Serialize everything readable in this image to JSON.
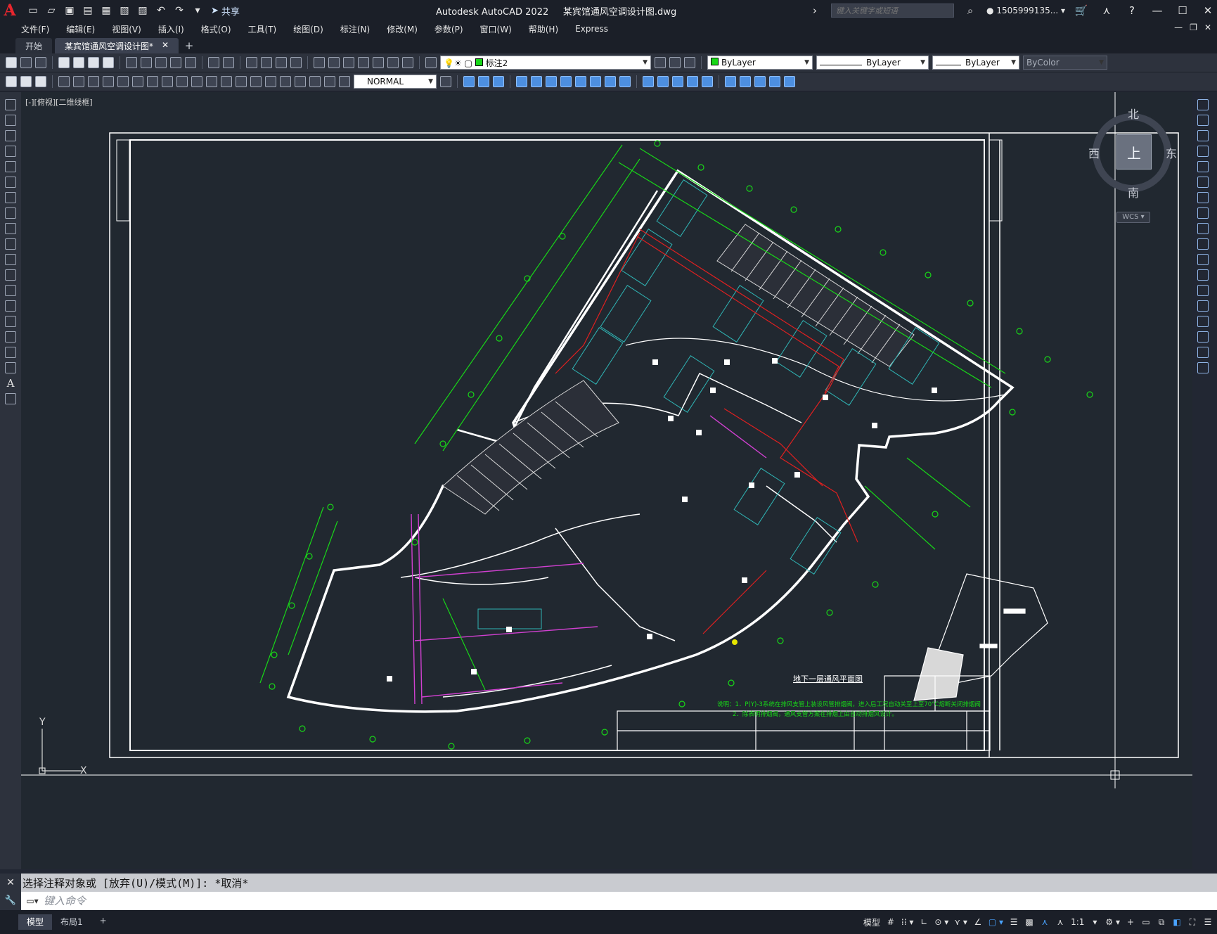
{
  "titlebar": {
    "app_letter": "A",
    "share_label": "共享",
    "app_name": "Autodesk AutoCAD 2022",
    "file_name": "某宾馆通风空调设计图.dwg",
    "search_placeholder": "键入关键字或短语",
    "user_name": "1505999135..."
  },
  "menu": {
    "items": [
      "文件(F)",
      "编辑(E)",
      "视图(V)",
      "插入(I)",
      "格式(O)",
      "工具(T)",
      "绘图(D)",
      "标注(N)",
      "修改(M)",
      "参数(P)",
      "窗口(W)",
      "帮助(H)",
      "Express"
    ]
  },
  "tabs": [
    {
      "label": "开始"
    },
    {
      "label": "某宾馆通风空调设计图*"
    }
  ],
  "toolbar": {
    "layer_name": "标注2",
    "color": "ByLayer",
    "linetype": "ByLayer",
    "lineweight": "ByLayer",
    "plotstyle": "ByColor",
    "dimstyle": "NORMAL",
    "layer_color": "#18d718"
  },
  "viewport": {
    "label": "[-][俯视][二维线框]",
    "viewcube": {
      "top": "上",
      "north": "北",
      "south": "南",
      "east": "东",
      "west": "西",
      "wcs": "WCS"
    }
  },
  "drawing": {
    "title": "地下一层通风平面图",
    "note1": "说明：1．P(Y)-3系统在排风支管上装设风管排烟阀，进入后工况自动关至上至70°C熔断关闭排烟阀",
    "note2": "2．除表明排烟阀，通风支管方案在排烟上由自动排烟风设计。",
    "ucs_y": "Y",
    "ucs_x": "X"
  },
  "command": {
    "history": "选择注释对象或 [放弃(U)/模式(M)]: *取消*",
    "placeholder": "键入命令"
  },
  "status": {
    "model_tab": "模型",
    "layout_tab": "布局1",
    "model_btn": "模型",
    "scale": "1:1"
  }
}
